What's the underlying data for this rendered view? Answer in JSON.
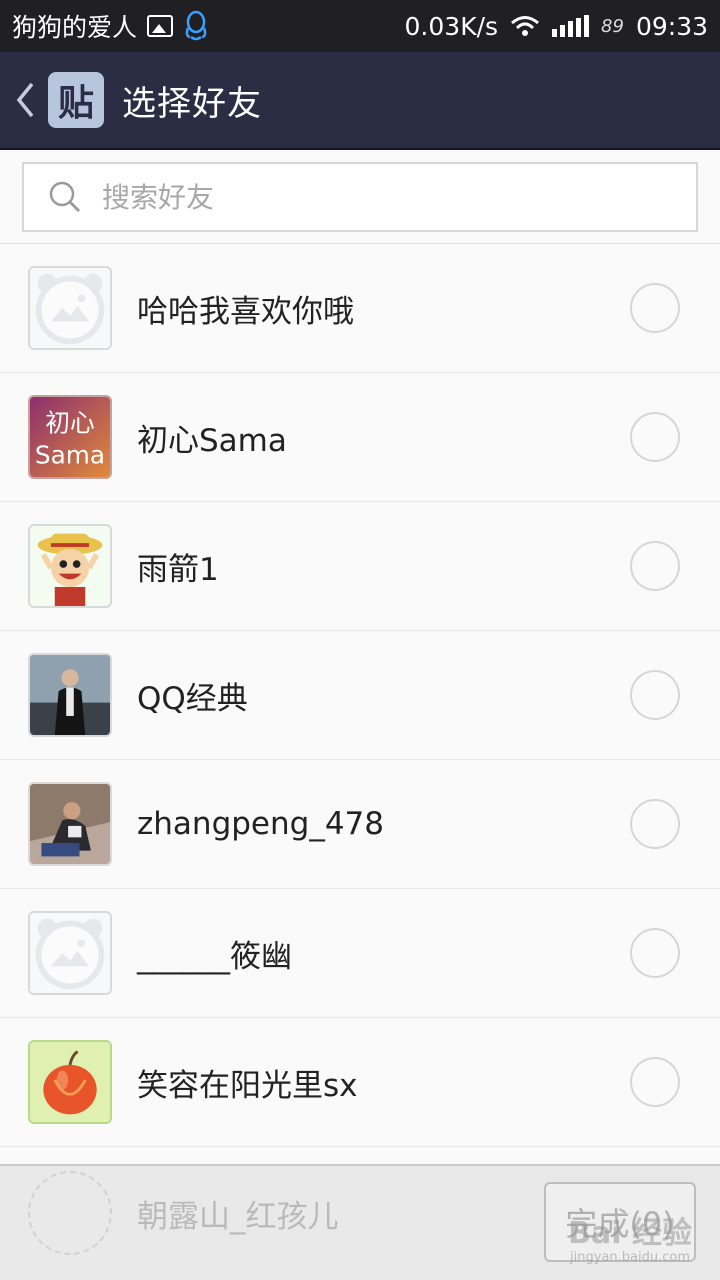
{
  "status_bar": {
    "carrier": "狗狗的爱人",
    "speed": "0.03K/s",
    "battery": "89",
    "time": "09:33"
  },
  "nav": {
    "logo_text": "贴",
    "title": "选择好友"
  },
  "search": {
    "placeholder": "搜索好友"
  },
  "friends": [
    {
      "name": "哈哈我喜欢你哦",
      "avatar": "default-avatar",
      "selected": false
    },
    {
      "name": "初心Sama",
      "avatar": "text-avatar",
      "avatar_text_top": "初心",
      "avatar_text_bottom": "Sama",
      "selected": false
    },
    {
      "name": "雨箭1",
      "avatar": "cartoon-avatar",
      "selected": false
    },
    {
      "name": "QQ经典",
      "avatar": "photo-avatar",
      "selected": false
    },
    {
      "name": "zhangpeng_478",
      "avatar": "photo-avatar",
      "selected": false
    },
    {
      "name": "______筱幽",
      "avatar": "default-avatar",
      "selected": false
    },
    {
      "name": "笑容在阳光里sx",
      "avatar": "apple-avatar",
      "selected": false
    }
  ],
  "partial_friend": {
    "name": "朝露山_红孩儿"
  },
  "bottom": {
    "done_label": "完成(0)"
  },
  "watermark": {
    "text": "Bai 经验",
    "url": "jingyan.baidu.com"
  },
  "colors": {
    "status_bg": "#1f1f24",
    "nav_bg": "#2b2d45",
    "logo_bg": "#b7c6dc"
  }
}
